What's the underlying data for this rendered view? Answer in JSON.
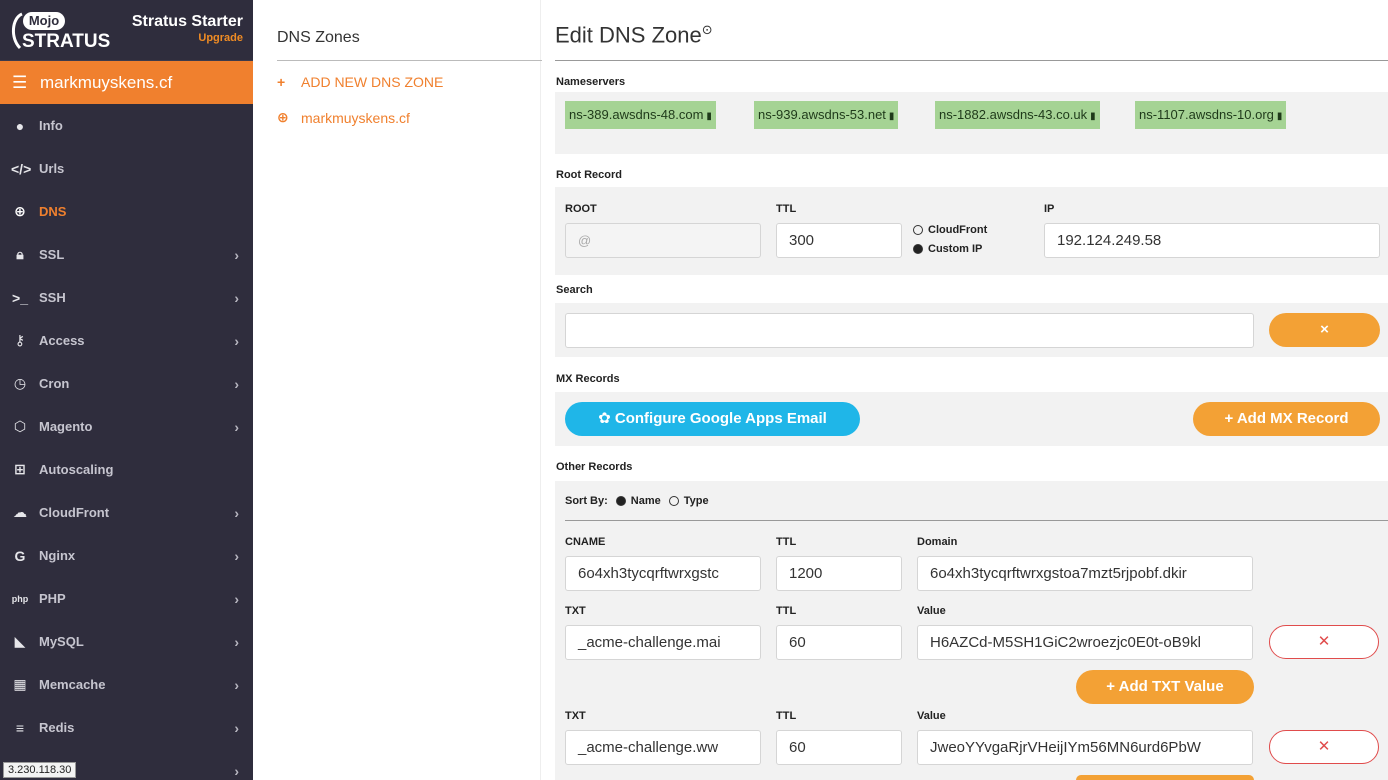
{
  "brand": {
    "logo_top": "Mojo",
    "logo_bottom": "STRATUS",
    "plan": "Stratus Starter",
    "upgrade": "Upgrade"
  },
  "site": {
    "name": "markmuyskens.cf"
  },
  "nav": {
    "items": [
      {
        "label": "Info"
      },
      {
        "label": "Urls"
      },
      {
        "label": "DNS"
      },
      {
        "label": "SSL"
      },
      {
        "label": "SSH"
      },
      {
        "label": "Access"
      },
      {
        "label": "Cron"
      },
      {
        "label": "Magento"
      },
      {
        "label": "Autoscaling"
      },
      {
        "label": "CloudFront"
      },
      {
        "label": "Nginx"
      },
      {
        "label": "PHP"
      },
      {
        "label": "MySQL"
      },
      {
        "label": "Memcache"
      },
      {
        "label": "Redis"
      }
    ]
  },
  "ip_tooltip": "3.230.118.30",
  "zones": {
    "title": "DNS Zones",
    "add_label": "ADD NEW DNS ZONE",
    "zone_name": "markmuyskens.cf"
  },
  "main": {
    "title": "Edit DNS Zone",
    "help_glyph": "?",
    "nameservers_label": "Nameservers",
    "nameservers": [
      "ns-389.awsdns-48.com",
      "ns-939.awsdns-53.net",
      "ns-1882.awsdns-43.co.uk",
      "ns-1107.awsdns-10.org"
    ],
    "root": {
      "section_label": "Root Record",
      "root_label": "ROOT",
      "root_placeholder": "@",
      "ttl_label": "TTL",
      "ttl_value": "300",
      "opt_cloudfront": "CloudFront",
      "opt_custom": "Custom IP",
      "ip_label": "IP",
      "ip_value": "192.124.249.58"
    },
    "search": {
      "section_label": "Search",
      "value": "",
      "clear_glyph": "×"
    },
    "mx": {
      "section_label": "MX Records",
      "google_btn": "Configure Google Apps Email",
      "add_btn": "Add MX Record"
    },
    "other": {
      "section_label": "Other Records",
      "sort_label": "Sort By:",
      "sort_name": "Name",
      "sort_type": "Type",
      "records": [
        {
          "type": "CNAME",
          "ttl_label": "TTL",
          "value_label": "Domain",
          "name": "6o4xh3tycqrftwrxgstc",
          "ttl": "1200",
          "value": "6o4xh3tycqrftwrxgstoa7mzt5rjpobf.dkir"
        },
        {
          "type": "TXT",
          "ttl_label": "TTL",
          "value_label": "Value",
          "name": "_acme-challenge.mai",
          "ttl": "60",
          "value": "H6AZCd-M5SH1GiC2wroezjc0E0t-oB9kl"
        },
        {
          "type": "TXT",
          "ttl_label": "TTL",
          "value_label": "Value",
          "name": "_acme-challenge.ww",
          "ttl": "60",
          "value": "JweoYYvgaRjrVHeijIYm56MN6urd6PbW"
        }
      ],
      "add_txt_btn": "Add TXT Value",
      "delete_glyph": "✕"
    }
  },
  "colors": {
    "sidebar": "#2f2d3d",
    "accent": "#f0802e",
    "chip": "#a5d394",
    "blue": "#1fb6e8"
  }
}
